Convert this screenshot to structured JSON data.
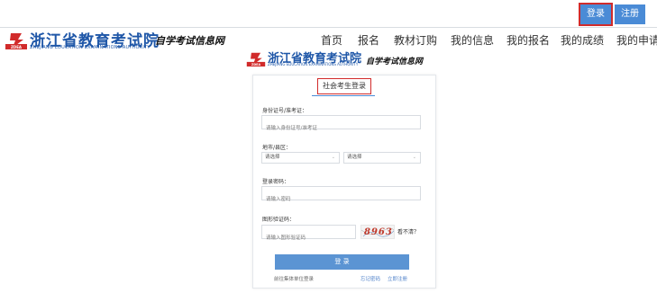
{
  "top_bar": {
    "login": "登录",
    "register": "注册"
  },
  "brand": {
    "title": "浙江省教育考试院",
    "subtitle": "ZHEJIANG EDUCATION EXAMINATIONS AUTHORITY",
    "suffix": "自学考试信息网",
    "icon_text": "ZDEA",
    "icon_color": "#d12b2b"
  },
  "nav": [
    "首页",
    "报名",
    "教材订购",
    "我的信息",
    "我的报名",
    "我的成绩",
    "我的申请"
  ],
  "form": {
    "tab": "社会考生登录",
    "id_label": "身份证号/准考证：",
    "id_placeholder": "请输入身份证号/准考证",
    "region_label": "地市/县区：",
    "city_select": "请选择",
    "county_select": "请选择",
    "password_label": "登录密码：",
    "password_placeholder": "请输入密码",
    "captcha_label": "图形验证码：",
    "captcha_placeholder": "请输入图形验证码",
    "captcha_value": "8963",
    "captcha_refresh": "看不清？",
    "submit": "登 录",
    "group_login_link": "前往集体单位登录",
    "forgot_link": "忘记密码",
    "register_link": "立即注册"
  },
  "colors": {
    "accent": "#4a8bd6",
    "brand_blue": "#1f57a8",
    "highlight": "#d12b2b"
  }
}
